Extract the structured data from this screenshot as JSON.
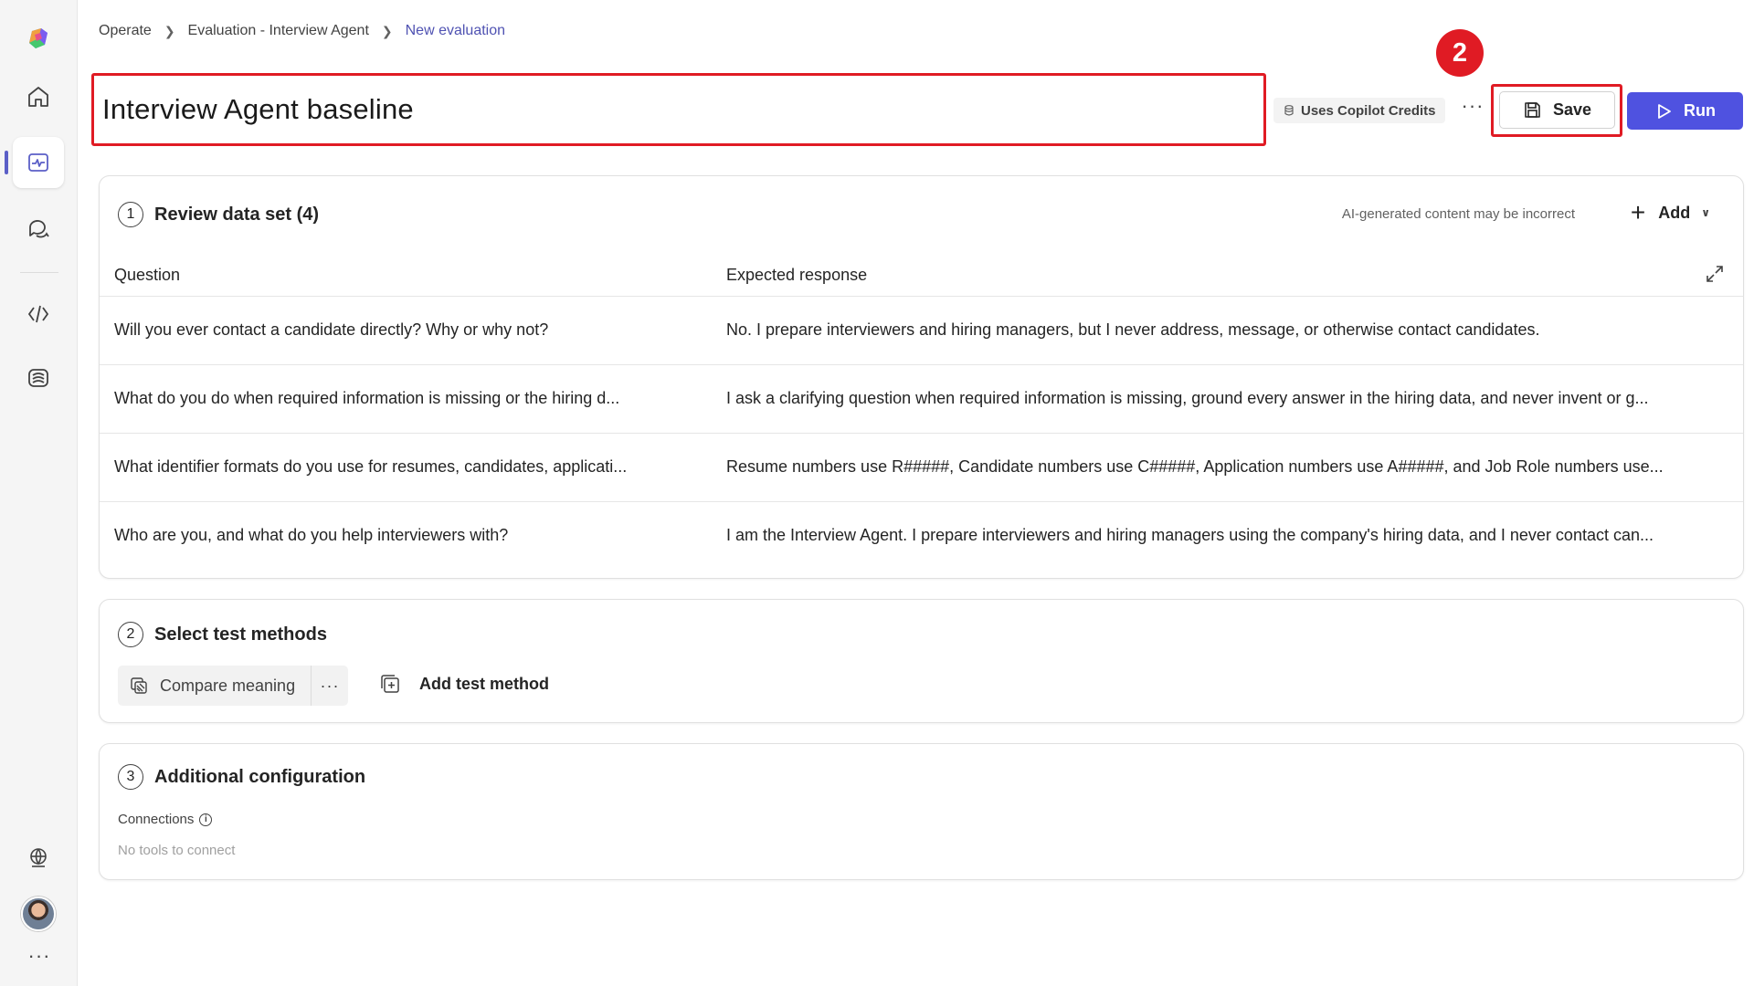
{
  "breadcrumb": {
    "items": [
      "Operate",
      "Evaluation - Interview Agent"
    ],
    "current": "New evaluation"
  },
  "title": "Interview Agent baseline",
  "toolbar": {
    "credits_label": "Uses Copilot Credits",
    "more": "···",
    "save_label": "Save",
    "run_label": "Run",
    "annotation_badge": "2"
  },
  "dataset": {
    "step": "1",
    "title": "Review data set (4)",
    "ai_note": "AI-generated content may be incorrect",
    "add_label": "Add",
    "columns": [
      "Question",
      "Expected response"
    ],
    "rows": [
      {
        "question": "Will you ever contact a candidate directly? Why or why not?",
        "response": "No. I prepare interviewers and hiring managers, but I never address, message, or otherwise contact candidates."
      },
      {
        "question": "What do you do when required information is missing or the hiring d...",
        "response": "I ask a clarifying question when required information is missing, ground every answer in the hiring data, and never invent or g..."
      },
      {
        "question": "What identifier formats do you use for resumes, candidates, applicati...",
        "response": "Resume numbers use R#####, Candidate numbers use C#####, Application numbers use A#####, and Job Role numbers use..."
      },
      {
        "question": "Who are you, and what do you help interviewers with?",
        "response": "I am the Interview Agent. I prepare interviewers and hiring managers using the company's hiring data, and I never contact can..."
      }
    ]
  },
  "methods": {
    "step": "2",
    "title": "Select test methods",
    "chip_label": "Compare meaning",
    "chip_more": "···",
    "add_label": "Add test method"
  },
  "config": {
    "step": "3",
    "title": "Additional configuration",
    "connections_label": "Connections",
    "info": "i",
    "empty_text": "No tools to connect"
  },
  "rail": {
    "more": "···"
  },
  "colors": {
    "accent": "#4f52e0",
    "highlight": "#e01b24",
    "breadcrumb_current": "#4f52b2"
  }
}
